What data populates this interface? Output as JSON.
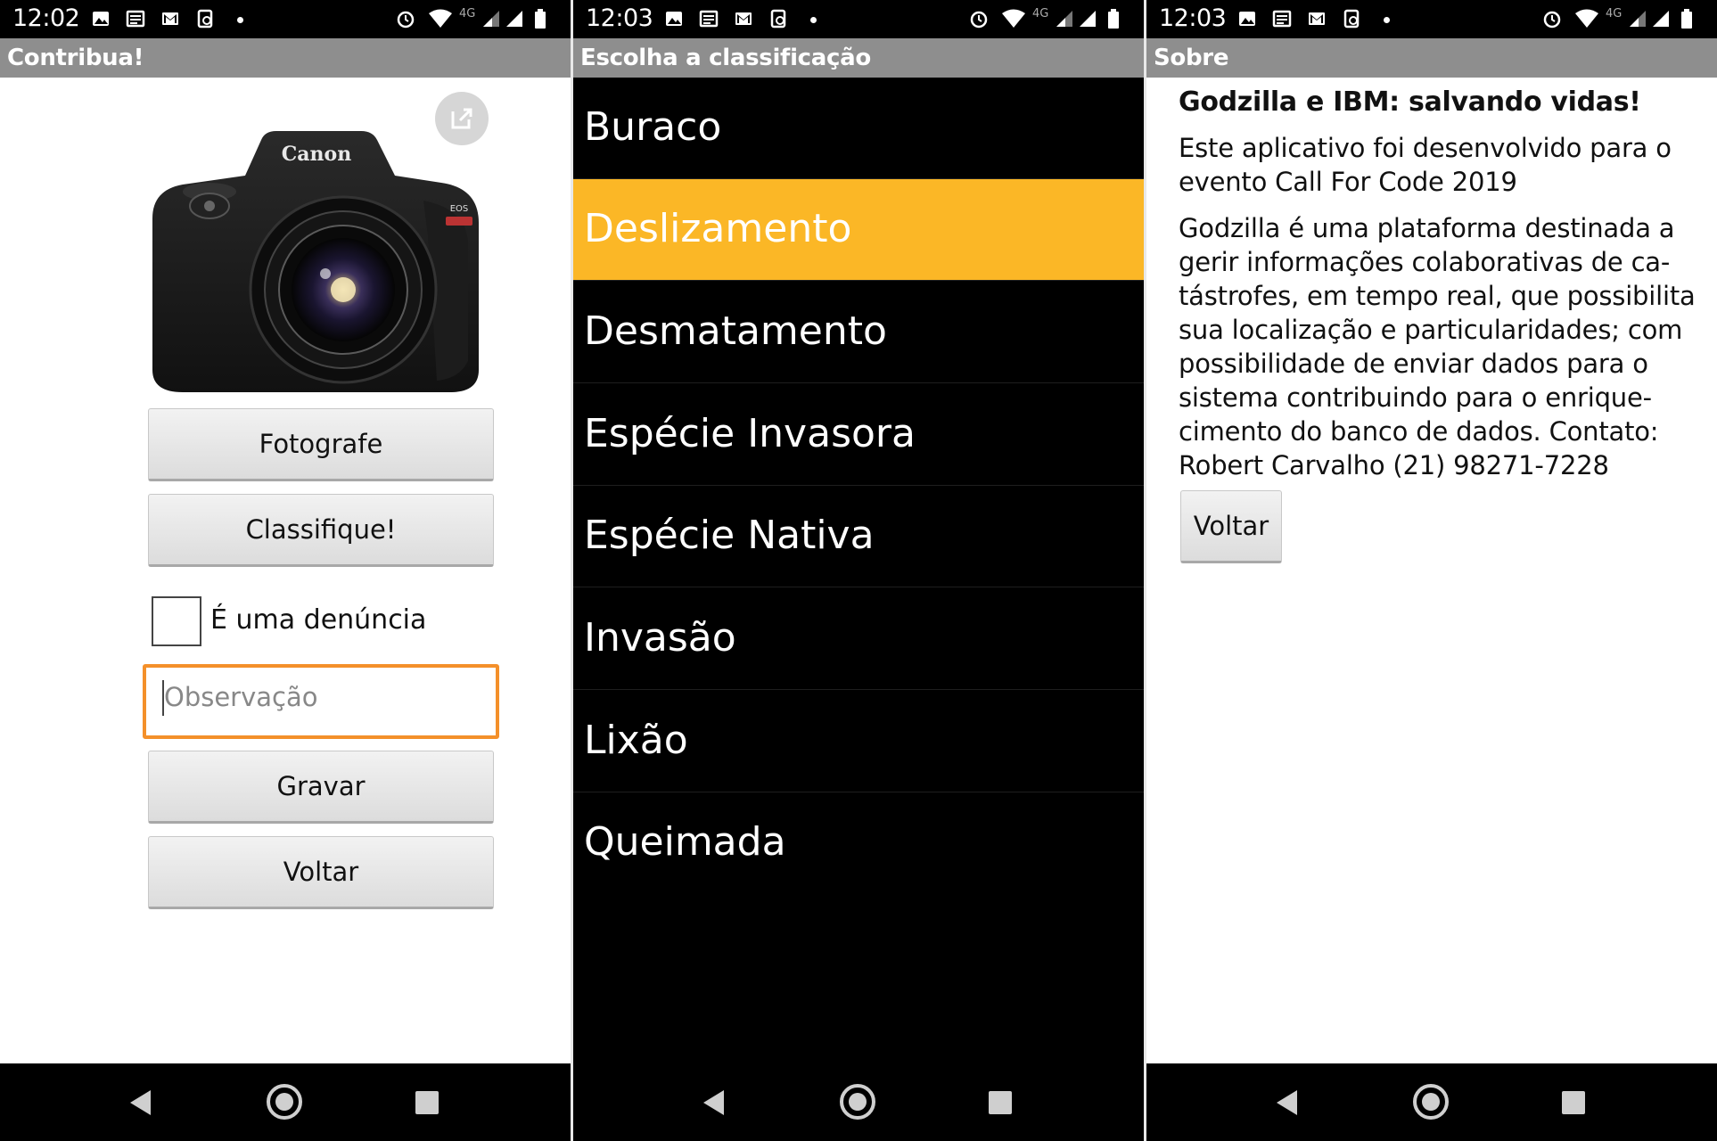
{
  "status_bars": [
    {
      "time": "12:02",
      "network": "4G"
    },
    {
      "time": "12:03",
      "network": "4G"
    },
    {
      "time": "12:03",
      "network": "4G"
    }
  ],
  "screen1": {
    "title": "Contribua!",
    "image_brand": "Canon",
    "buttons": {
      "photograph": "Fotografe",
      "classify": "Classifique!",
      "save": "Gravar",
      "back": "Voltar"
    },
    "checkbox_label": "É uma denúncia",
    "checkbox_checked": false,
    "observation_placeholder": "Observação",
    "observation_value": ""
  },
  "screen2": {
    "title": "Escolha a classificação",
    "selected_index": 1,
    "selected_color": "#fbb726",
    "items": [
      {
        "label": "Buraco"
      },
      {
        "label": "Deslizamento"
      },
      {
        "label": "Desmatamento"
      },
      {
        "label": "Espécie Invasora"
      },
      {
        "label": "Espécie Nativa"
      },
      {
        "label": "Invasão"
      },
      {
        "label": "Lixão"
      },
      {
        "label": "Queimada"
      }
    ]
  },
  "screen3": {
    "title": "Sobre",
    "heading": "Godzilla e IBM: salvando vidas!",
    "paragraph1": [
      "Este aplicativo foi desenvolvido para o",
      "evento Call For Code 2019"
    ],
    "paragraph2": [
      "Godzilla é uma plataforma destinada a",
      "gerir informações colaborativas de ca-",
      "tástrofes, em tempo real, que possibilita",
      "sua localização e particularidades; com",
      "possibilidade de enviar dados para o",
      "sistema contribuindo para o enrique-",
      "cimento do banco de dados. Contato:",
      "Robert Carvalho (21) 98271-7228"
    ],
    "back_button": "Voltar"
  },
  "colors": {
    "title_bar": "#8e8e8e",
    "accent_orange": "#f4902a",
    "selection": "#fbb726"
  }
}
